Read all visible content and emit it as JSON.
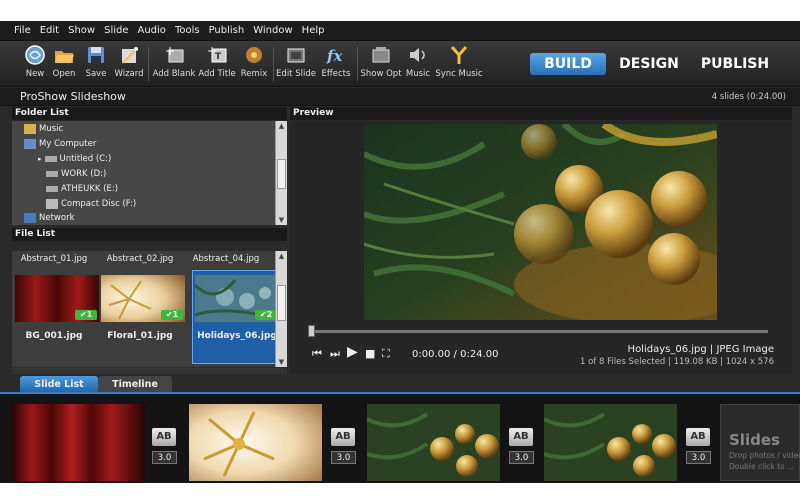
{
  "menu": [
    "File",
    "Edit",
    "Show",
    "Slide",
    "Audio",
    "Tools",
    "Publish",
    "Window",
    "Help"
  ],
  "toolbar": {
    "new": "New",
    "open": "Open",
    "save": "Save",
    "wizard": "Wizard",
    "add_blank": "Add Blank",
    "add_title": "Add Title",
    "remix": "Remix",
    "edit_slide": "Edit Slide",
    "effects": "Effects",
    "show_opt": "Show Opt",
    "music": "Music",
    "sync_music": "Sync Music"
  },
  "modes": {
    "build": "BUILD",
    "design": "DESIGN",
    "publish": "PUBLISH",
    "active": "BUILD"
  },
  "window": {
    "title": "ProShow Slideshow",
    "count": "4 slides (0:24.00)"
  },
  "folder_list": {
    "header": "Folder List",
    "items": [
      "Music",
      "My Computer",
      "Untitled (C:)",
      "WORK (D:)",
      "ATHEUKK (E:)",
      "Compact Disc (F:)",
      "Network"
    ]
  },
  "file_list": {
    "header": "File List",
    "top_names": [
      "Abstract_01.jpg",
      "Abstract_02.jpg",
      "Abstract_04.jpg"
    ],
    "files": [
      {
        "name": "BG_001.jpg",
        "uses": "1"
      },
      {
        "name": "Floral_01.jpg",
        "uses": "1"
      },
      {
        "name": "Holidays_06.jpg",
        "uses": "2",
        "selected": true
      }
    ]
  },
  "preview": {
    "header": "Preview",
    "time": "0:00.00 / 0:24.00",
    "file_info": "Holidays_06.jpg  |  JPEG Image",
    "file_meta": "1 of 8 Files Selected  |  119.08 KB  |  1024 x 576"
  },
  "tabs": {
    "slide_list": "Slide List",
    "timeline": "Timeline",
    "active": "Slide List"
  },
  "slides": [
    {
      "thumb": "curtain",
      "duration": "3.0"
    },
    {
      "thumb": "floral",
      "duration": "3.0"
    },
    {
      "thumb": "ornaments",
      "duration": "3.0"
    },
    {
      "thumb": "ornaments",
      "duration": "3.0"
    }
  ],
  "transition_label": "AB",
  "empty_slot": {
    "title": "Slides",
    "line1": "Drop photos / videos here.",
    "line2": "Double click to ..."
  },
  "colors": {
    "accent": "#2a6fb8",
    "check": "#3db83d"
  }
}
